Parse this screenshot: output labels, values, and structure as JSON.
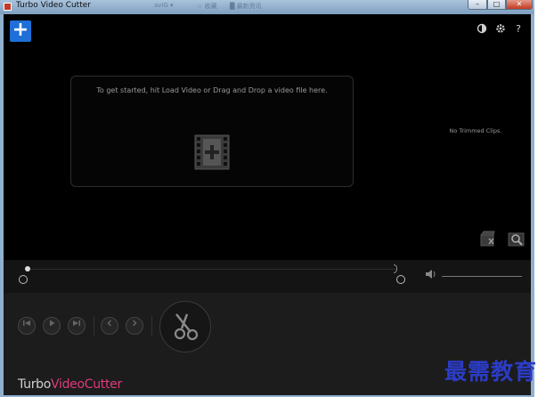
{
  "window": {
    "title": "Turbo Video Cutter",
    "background_text": [
      "aviG ▾",
      "☆ 收藏",
      "█ 最新资讯"
    ]
  },
  "window_controls": {
    "minimize": "–",
    "maximize": "□",
    "close": "✕"
  },
  "header": {
    "add_label": "+",
    "icons": [
      "contrast-icon",
      "gear-icon",
      "help-icon"
    ],
    "help_label": "?"
  },
  "main": {
    "drop_message": "To get started, hit Load Video or Drag and Drop a video file here.",
    "clips_message": "No Trimmed Clips."
  },
  "controls": {
    "buttons": [
      "previous-frame",
      "play",
      "next-frame",
      "step-back",
      "step-forward",
      "cut"
    ]
  },
  "branding": {
    "turbo": "Turbo",
    "video_cutter": "VideoCutter"
  },
  "watermark": {
    "text": "最需教育"
  },
  "colors": {
    "accent": "#1e6fd8",
    "brand_pink": "#e03b7b",
    "watermark": "#2b3cc6"
  }
}
